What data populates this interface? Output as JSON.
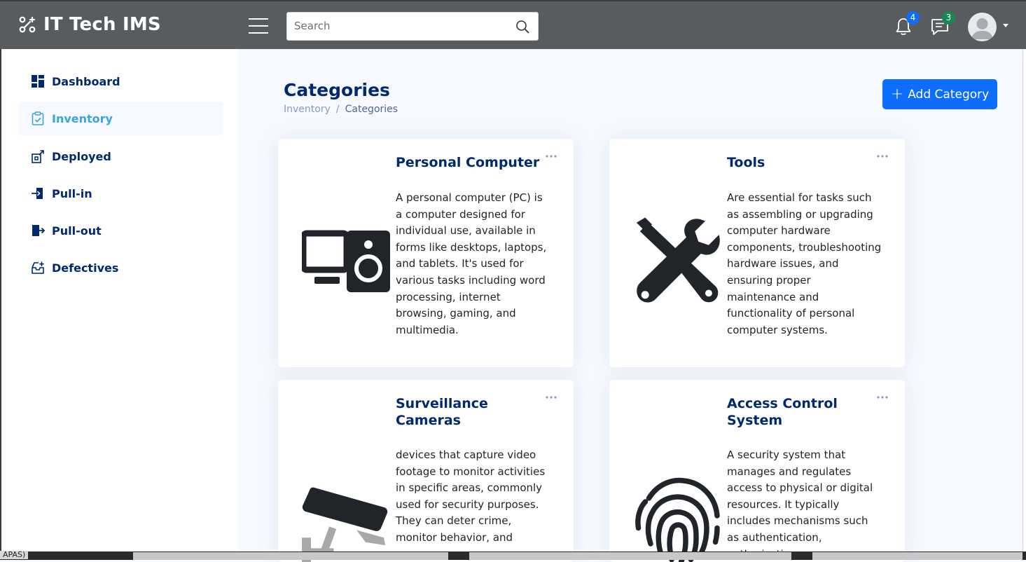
{
  "header": {
    "app_title": "IT Tech IMS",
    "search_placeholder": "Search",
    "notifications_count": "4",
    "messages_count": "3",
    "notifications_badge_color": "#0d6efd",
    "messages_badge_color": "#198754"
  },
  "sidebar": {
    "items": [
      {
        "label": "Dashboard",
        "icon": "grid-icon"
      },
      {
        "label": "Inventory",
        "icon": "clipboard-check-icon"
      },
      {
        "label": "Deployed",
        "icon": "box-arrow-up-icon"
      },
      {
        "label": "Pull-in",
        "icon": "box-arrow-in-icon"
      },
      {
        "label": "Pull-out",
        "icon": "box-arrow-out-icon"
      },
      {
        "label": "Defectives",
        "icon": "tray-plus-icon"
      }
    ]
  },
  "main": {
    "title": "Categories",
    "breadcrumb": [
      "Inventory",
      "Categories"
    ],
    "add_button_label": "Add Category",
    "cards": [
      {
        "title": "Personal Computer",
        "icon": "pc-display-icon",
        "text": "A personal computer (PC) is a computer designed for individual use, available in forms like desktops, laptops, and tablets. It's used for various tasks including word processing, internet browsing, gaming, and multimedia."
      },
      {
        "title": "Tools",
        "icon": "tools-icon",
        "text": "Are essential for tasks such as assembling or upgrading computer hardware components, troubleshooting hardware issues, and ensuring proper maintenance and functionality of personal computer systems."
      },
      {
        "title": "Surveillance Cameras",
        "icon": "security-camera-icon",
        "text": "devices that capture video footage to monitor activities in specific areas, commonly used for security purposes. They can deter crime, monitor behavior, and"
      },
      {
        "title": "Access Control System",
        "icon": "fingerprint-icon",
        "text": "A security system that manages and regulates access to physical or digital resources. It typically includes mechanisms such as authentication, authorization,"
      }
    ]
  },
  "taskbar": {
    "label": "APAS)"
  }
}
